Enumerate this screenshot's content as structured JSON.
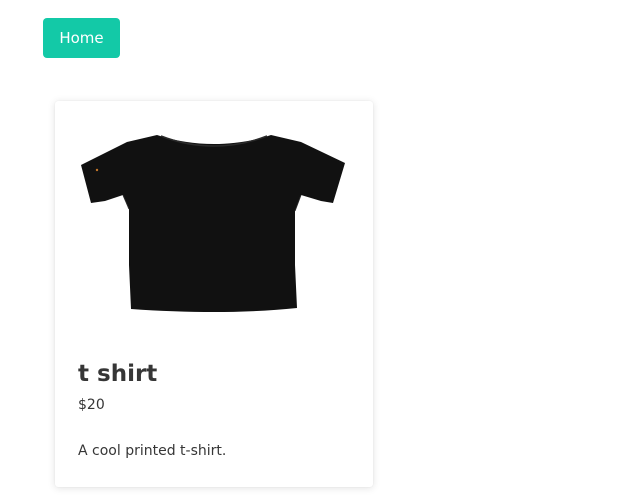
{
  "nav": {
    "home_label": "Home"
  },
  "product": {
    "image_icon": "t-shirt-image",
    "name": "t shirt",
    "price": "$20",
    "description": "A cool printed t-shirt."
  },
  "colors": {
    "accent": "#13c9a7",
    "text": "#363636",
    "shirt": "#111111"
  }
}
